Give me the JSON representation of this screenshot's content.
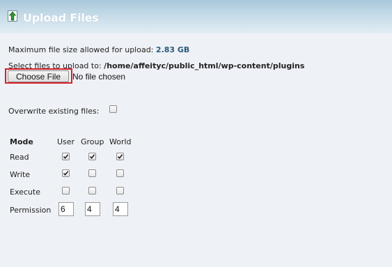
{
  "header": {
    "title": "Upload Files",
    "icon": "upload-arrow-icon"
  },
  "max_size": {
    "label": "Maximum file size allowed for upload:",
    "value": "2.83 GB"
  },
  "select_path": {
    "label": "Select files to upload to:",
    "path": "/home/affeityc/public_html/wp-content/plugins"
  },
  "file_input": {
    "button_label": "Choose File",
    "status": "No file chosen"
  },
  "overwrite": {
    "label": "Overwrite existing files:",
    "checked": false
  },
  "permissions": {
    "headers": {
      "mode": "Mode",
      "user": "User",
      "group": "Group",
      "world": "World"
    },
    "rows": [
      {
        "label": "Read",
        "user": true,
        "group": true,
        "world": true
      },
      {
        "label": "Write",
        "user": true,
        "group": false,
        "world": false
      },
      {
        "label": "Execute",
        "user": false,
        "group": false,
        "world": false
      }
    ],
    "permission_label": "Permission",
    "values": {
      "user": "6",
      "group": "4",
      "world": "4"
    }
  },
  "colors": {
    "highlight": "#d9202a",
    "header_top": "#a9c8da",
    "background": "#eef1f5"
  }
}
